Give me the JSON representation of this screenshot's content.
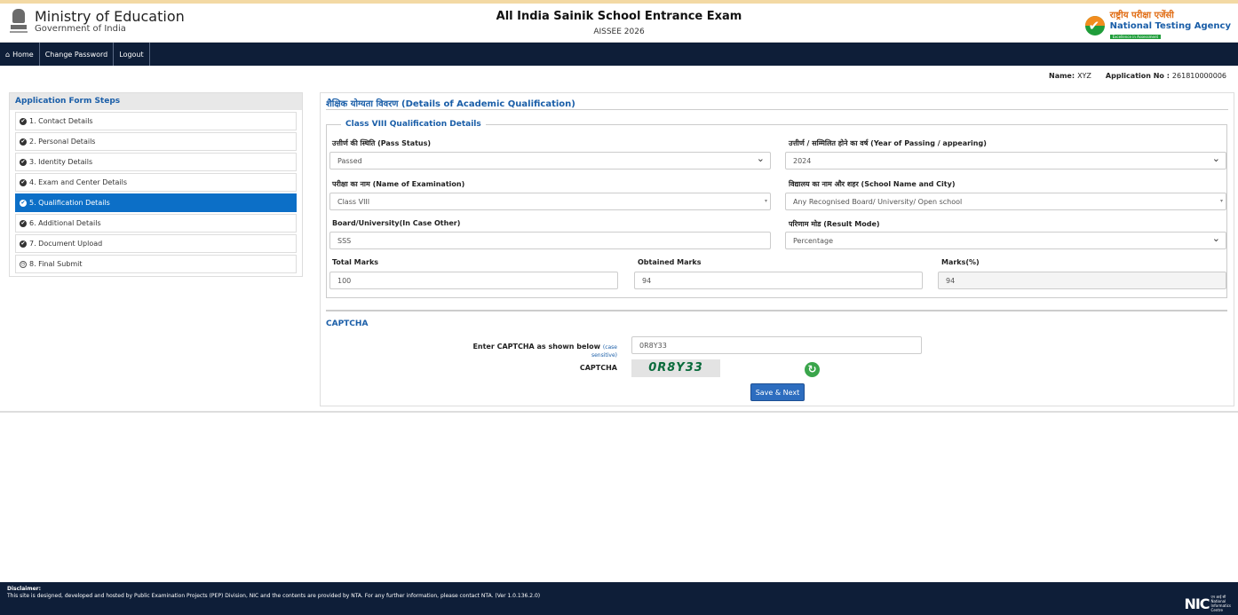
{
  "header": {
    "ministry_title": "Ministry of Education",
    "ministry_subtitle": "Government of India",
    "exam_title": "All India Sainik School Entrance Exam",
    "exam_code": "AISSEE 2026",
    "nta_hindi": "राष्ट्रीय परीक्षा एजेंसी",
    "nta_english": "National Testing Agency",
    "nta_tagline": "Excellence in Assessment"
  },
  "nav": {
    "home": "Home",
    "change_password": "Change Password",
    "logout": "Logout"
  },
  "user": {
    "name_label": "Name:",
    "name_value": "XYZ",
    "app_label": "Application No :",
    "app_value": "261810000006"
  },
  "sidebar": {
    "title": "Application Form Steps",
    "items": [
      {
        "label": "1. Contact Details",
        "state": "done"
      },
      {
        "label": "2. Personal Details",
        "state": "done"
      },
      {
        "label": "3. Identity Details",
        "state": "done"
      },
      {
        "label": "4. Exam and Center Details",
        "state": "done"
      },
      {
        "label": "5. Qualification Details",
        "state": "active"
      },
      {
        "label": "6. Additional Details",
        "state": "done"
      },
      {
        "label": "7. Document Upload",
        "state": "done"
      },
      {
        "label": "8. Final Submit",
        "state": "pending"
      }
    ]
  },
  "form": {
    "section_title": "शैक्षिक योग्यता विवरण (Details of Academic Qualification)",
    "legend": "Class VIII Qualification Details",
    "pass_status_label": "उत्तीर्ण की स्थिति (Pass Status)",
    "pass_status_value": "Passed",
    "year_label": "उत्तीर्ण / सम्मिलित होने का वर्ष (Year of Passing / appearing)",
    "year_value": "2024",
    "exam_name_label": "परीक्षा का नाम (Name of Examination)",
    "exam_name_value": "Class VIII",
    "school_label": "विद्यालय का नाम और शहर (School Name and City)",
    "school_value": "Any Recognised Board/ University/ Open school",
    "board_label": "Board/University(In Case Other)",
    "board_value": "SSS",
    "result_mode_label": "परिणाम मोड (Result Mode)",
    "result_mode_value": "Percentage",
    "total_marks_label": "Total Marks",
    "total_marks_value": "100",
    "obtained_marks_label": "Obtained Marks",
    "obtained_marks_value": "94",
    "percent_label": "Marks(%)",
    "percent_value": "94"
  },
  "captcha": {
    "title": "CAPTCHA",
    "enter_label": "Enter CAPTCHA as shown below",
    "case_note": "(case sensitive)",
    "input_value": "0R8Y33",
    "captcha_label": "CAPTCHA",
    "captcha_text": "0R8Y33",
    "save_button": "Save & Next"
  },
  "footer": {
    "disclaimer_title": "Disclaimer:",
    "disclaimer_text": "This site is designed, developed and hosted by Public Examination Projects (PEP) Division, NIC and the contents are provided by NTA. For any further information, please contact NTA. (Ver 1.0.136.2.0)",
    "nic_mark": "NIC",
    "nic_hindi": "एन आई सी",
    "nic_line1": "National",
    "nic_line2": "Informatics",
    "nic_line3": "Centre"
  },
  "colors": {
    "navbar": "#0e1e38",
    "accent": "#1a5ea8",
    "active_step": "#0c6fc7",
    "button": "#2d6dbf"
  }
}
